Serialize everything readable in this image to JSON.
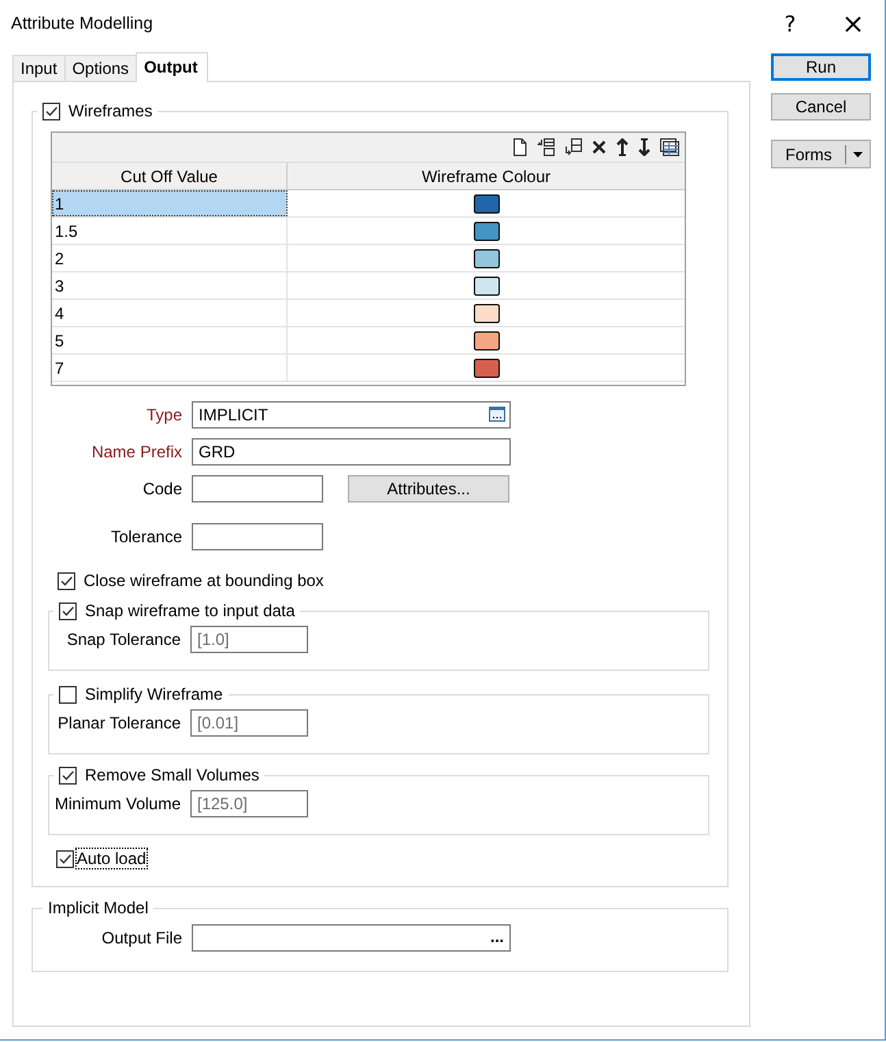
{
  "window": {
    "title": "Attribute Modelling",
    "help": "?",
    "close": "×"
  },
  "tabs": [
    {
      "label": "Input",
      "selected": false
    },
    {
      "label": "Options",
      "selected": false
    },
    {
      "label": "Output",
      "selected": true
    }
  ],
  "wireframes": {
    "label": "Wireframes",
    "checked": true,
    "grid": {
      "columns": [
        "Cut Off Value",
        "Wireframe Colour"
      ],
      "rows": [
        {
          "value": "1",
          "color": "#2166ac",
          "selected": true
        },
        {
          "value": "1.5",
          "color": "#4393c3",
          "selected": false
        },
        {
          "value": "2",
          "color": "#92c5de",
          "selected": false
        },
        {
          "value": "3",
          "color": "#d1e5f0",
          "selected": false
        },
        {
          "value": "4",
          "color": "#fddbc7",
          "selected": false
        },
        {
          "value": "5",
          "color": "#f4a582",
          "selected": false
        },
        {
          "value": "7",
          "color": "#d6604d",
          "selected": false
        }
      ]
    },
    "fields": [
      {
        "kind": "browse",
        "label": "Type",
        "required": true,
        "value": "IMPLICIT"
      },
      {
        "kind": "text",
        "label": "Name Prefix",
        "required": true,
        "value": "GRD"
      },
      {
        "kind": "short",
        "label": "Code",
        "required": false,
        "button": "Attributes..."
      },
      {
        "kind": "short",
        "label": "Tolerance",
        "required": false
      }
    ],
    "close_at_bounding_box": {
      "label": "Close wireframe at bounding box",
      "checked": true
    },
    "option_groups": [
      {
        "label": "Snap wireframe to input data",
        "checked": true,
        "field_label": "Snap Tolerance",
        "placeholder": "[1.0]"
      },
      {
        "label": "Simplify Wireframe",
        "checked": false,
        "field_label": "Planar Tolerance",
        "placeholder": "[0.01]"
      },
      {
        "label": "Remove Small Volumes",
        "checked": true,
        "field_label": "Minimum Volume",
        "placeholder": "[125.0]"
      }
    ],
    "auto_load": {
      "label": "Auto load",
      "checked": true,
      "focused": true
    }
  },
  "implicit_model": {
    "title": "Implicit Model",
    "field_label": "Output File",
    "browse": "..."
  },
  "buttons": [
    {
      "label": "Run",
      "default": true
    },
    {
      "label": "Cancel",
      "default": false
    }
  ],
  "forms_button": {
    "label": "Forms"
  }
}
